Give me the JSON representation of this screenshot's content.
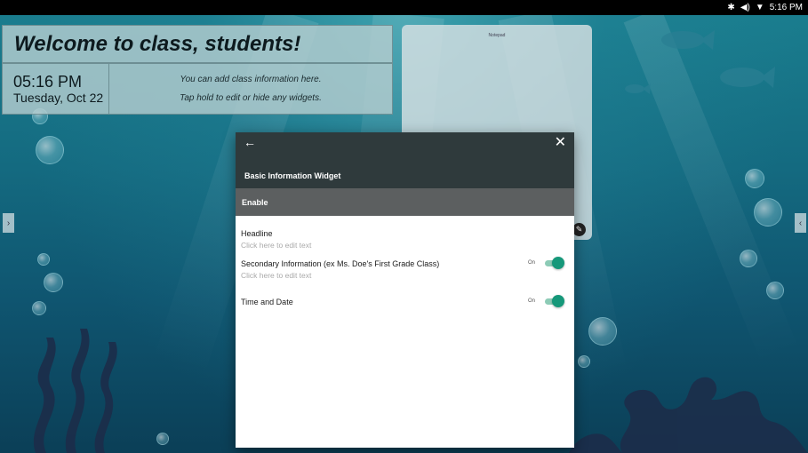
{
  "status_bar": {
    "time": "5:16 PM",
    "icons": [
      "bluetooth-icon",
      "volume-icon",
      "wifi-icon"
    ]
  },
  "background": {
    "theme": "underwater ocean"
  },
  "widgets": {
    "headline": "Welcome to class, students!",
    "clock": {
      "time": "05:16 PM",
      "date": "Tuesday, Oct 22"
    },
    "secondary": {
      "line1": "You can add class information here.",
      "line2": "Tap hold to edit or hide any widgets."
    },
    "notepad": {
      "title": "Notepad"
    }
  },
  "dialog": {
    "back_icon": "arrow-left-icon",
    "close_icon": "close-icon",
    "title": "Basic Information Widget",
    "enable_label": "Enable",
    "settings": [
      {
        "label": "Headline",
        "sub": "Click here to edit text"
      },
      {
        "label": "Secondary Information (ex Ms. Doe's First Grade Class)",
        "sub": "Click here to edit text",
        "toggle_label": "On",
        "toggle_on": true
      },
      {
        "label": "Time and Date",
        "toggle_label": "On",
        "toggle_on": true
      }
    ]
  },
  "colors": {
    "dialog_header": "#2f3a3c",
    "enable_bar": "#5c5f60",
    "toggle_accent": "#16987a"
  }
}
